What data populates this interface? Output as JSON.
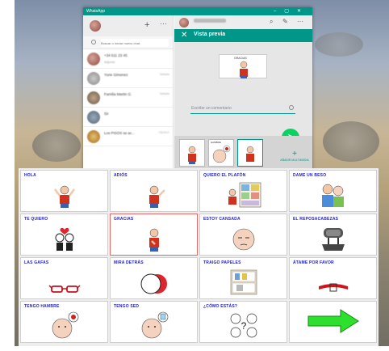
{
  "whatsapp": {
    "title": "WhatsApp",
    "search_placeholder": "Buscar o iniciar nuevo chat",
    "chats": [
      {
        "name": "+34 611 23 45",
        "msg": "Adjunto",
        "time": ""
      },
      {
        "name": "Yurie Gimenez",
        "msg": "",
        "time": "Sábado"
      },
      {
        "name": "Familia Martin G.",
        "msg": "",
        "time": "Sábado"
      },
      {
        "name": "Sir",
        "msg": "",
        "time": ""
      },
      {
        "name": "Los PISOS se ac...",
        "msg": "",
        "time": "7/5/2017"
      }
    ],
    "preview": {
      "close": "✕",
      "title": "Vista previa",
      "image_label": "GRACIAS",
      "comment_placeholder": "Escribe un comentario",
      "add_media_plus": "+",
      "add_media_label": "AÑADIR MULTIMEDIA",
      "thumb_label": "HAMBRE",
      "send_icon": "➤"
    }
  },
  "board": {
    "cells": [
      {
        "label": "HOLA",
        "icon": "wave-person-icon"
      },
      {
        "label": "ADIÓS",
        "icon": "goodbye-person-icon"
      },
      {
        "label": "QUIERO EL PLAFÓN",
        "icon": "letter-board-icon"
      },
      {
        "label": "DAME UN BESO",
        "icon": "kiss-icon"
      },
      {
        "label": "TE QUIERO",
        "icon": "love-couple-icon"
      },
      {
        "label": "GRACIAS",
        "icon": "thanks-person-icon"
      },
      {
        "label": "ESTOY CANSADA",
        "icon": "tired-face-icon"
      },
      {
        "label": "EL REPOSACABEZAS",
        "icon": "headrest-icon"
      },
      {
        "label": "LAS GAFAS",
        "icon": "glasses-icon"
      },
      {
        "label": "MIRA DETRÁS",
        "icon": "look-behind-icon"
      },
      {
        "label": "TRAIGO PAPELES",
        "icon": "papers-icon"
      },
      {
        "label": "ÁTAME POR FAVOR",
        "icon": "belt-icon"
      },
      {
        "label": "TENGO HAMBRE",
        "icon": "hungry-face-icon"
      },
      {
        "label": "TENGO SED",
        "icon": "thirsty-face-icon"
      },
      {
        "label": "¿CÓMO ESTÁS?",
        "icon": "how-are-you-icon"
      },
      {
        "label": "",
        "icon": "next-arrow-icon"
      }
    ]
  }
}
